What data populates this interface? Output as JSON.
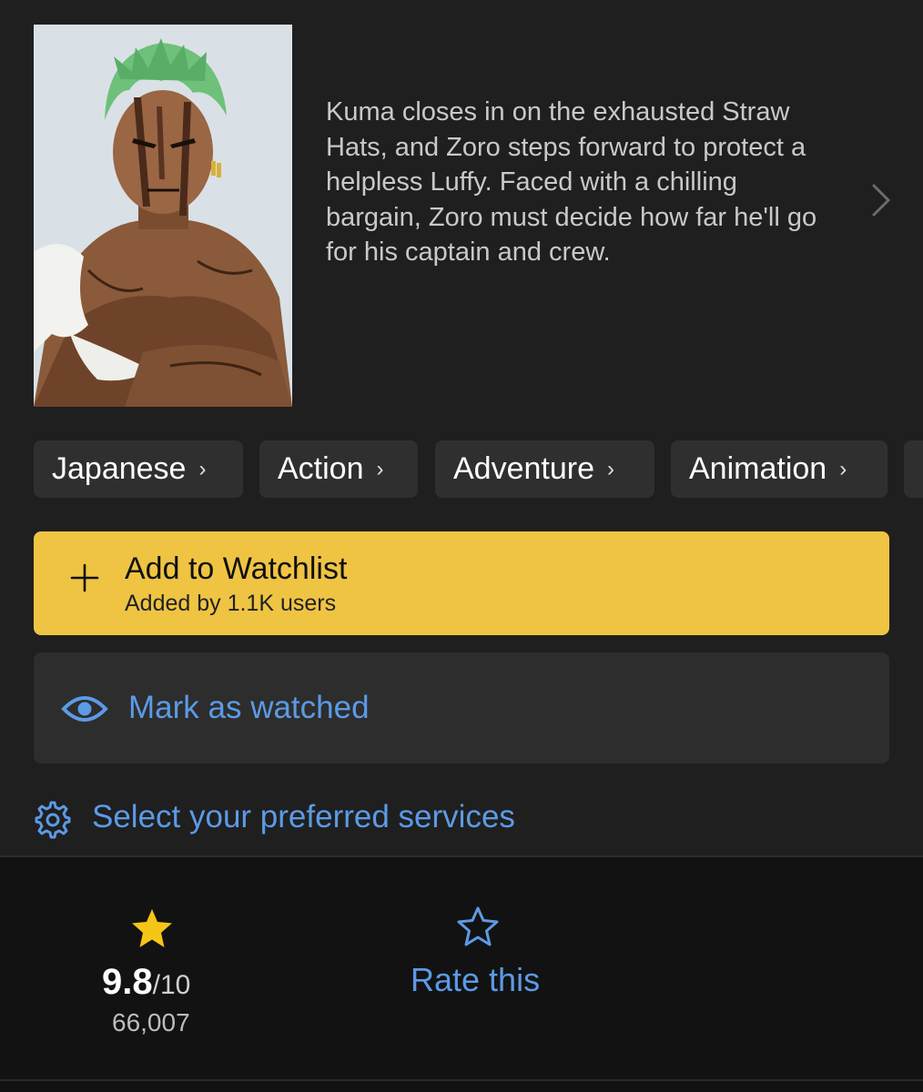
{
  "header": {
    "poster_alt": "Zoro poster",
    "synopsis": "Kuma closes in on the exhausted Straw Hats, and Zoro steps forward to protect a helpless Luffy. Faced with a chilling bargain, Zoro must decide how far he'll go for his captain and crew."
  },
  "genres": [
    {
      "label": "Japanese"
    },
    {
      "label": "Action"
    },
    {
      "label": "Adventure"
    },
    {
      "label": "Animation"
    }
  ],
  "genre_chevron": "›",
  "watchlist": {
    "title": "Add to Watchlist",
    "subtitle": "Added by 1.1K users",
    "color": "#efc443"
  },
  "watched": {
    "label": "Mark as watched"
  },
  "services": {
    "label": "Select your preferred services"
  },
  "rating": {
    "value": "9.8",
    "max": "/10",
    "count": "66,007",
    "star_color": "#f5c518"
  },
  "rate": {
    "label": "Rate this"
  },
  "colors": {
    "accent_blue": "#5c9ae6",
    "background": "#1f1f1f"
  }
}
